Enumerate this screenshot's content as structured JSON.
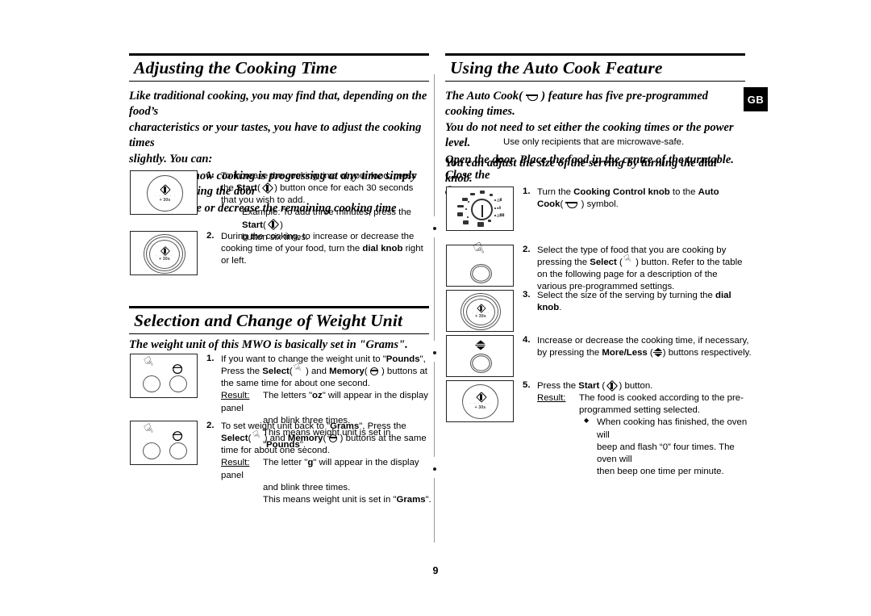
{
  "page": {
    "number": "9",
    "locale_badge": "GB"
  },
  "left_column": {
    "section1": {
      "heading": "Adjusting the Cooking Time",
      "intro": [
        "Like traditional cooking, you may find that, depending on the food’s",
        "characteristics or your tastes, you have to adjust the cooking times",
        "slightly. You can:"
      ],
      "bullets": [
        "Check how cooking is progressing at any time simply by opening the door",
        "Increase or decrease the remaining cooking time"
      ],
      "steps": [
        {
          "num": "1.",
          "line1_a": "To increase the cooking time of your food, press the",
          "line2_a": "Start",
          "line2_b": ") button once for each 30 seconds that you wish",
          "line3": "to add.",
          "sub_a": "Example: To add three minutes, press the ",
          "sub_b": "Start",
          "sub_c": ")",
          "sub_d": "button six times.",
          "panel": {
            "icon": "start-button-panel",
            "label": "+ 30s"
          }
        },
        {
          "num": "2.",
          "line1": "During the cooking, to increase or decrease the cooking",
          "line2_a": "time of your food, turn the ",
          "line2_b": "dial knob",
          "line2_c": " right or left.",
          "panel": {
            "icon": "dial-knob-panel",
            "label": "+ 30s"
          }
        }
      ]
    },
    "section2": {
      "heading": "Selection and Change of Weight Unit",
      "intro": [
        "The weight unit of this MWO is basically set in \"Grams\"."
      ],
      "steps": [
        {
          "num": "1.",
          "line1_a": "If you want to change the weight unit to \"",
          "line1_b": "Pounds",
          "line1_c": "\",",
          "line2_a": "Press the ",
          "line2_b": "Select",
          "line2_c": ") and ",
          "line2_d": "Memory",
          "line2_e": ") buttons at the",
          "line3": "same time for about one second.",
          "result_label": "Result:",
          "result_1a": "The letters \"",
          "result_1b": "oz",
          "result_1c": "\" will appear in the display panel",
          "result_2": "and blink three times.",
          "result_3a": "This means weight unit is set in \"",
          "result_3b": "Pounds",
          "result_3c": "\".",
          "panel": {
            "icon": "select-memory-buttons-panel"
          }
        },
        {
          "num": "2.",
          "line1_a": "To set weight unit back to \"",
          "line1_b": "Grams",
          "line1_c": "\",",
          "line2_a": "Press the ",
          "line2_b": "Select",
          "line2_c": ") and ",
          "line2_d": "Memory",
          "line2_e": ") buttons at the",
          "line3": "same time for about one second.",
          "result_label": "Result:",
          "result_1a": "The letter \"",
          "result_1b": "g",
          "result_1c": "\" will appear in the display panel",
          "result_2": "and blink three times.",
          "result_3a": "This means weight unit is set in \"",
          "result_3b": "Grams",
          "result_3c": "\".",
          "panel": {
            "icon": "select-memory-buttons-panel"
          }
        }
      ]
    }
  },
  "right_column": {
    "section1": {
      "heading": "Using the Auto Cook Feature",
      "intro_1a": "The Auto Cook(",
      "intro_1b": ") feature has five pre-programmed cooking times.",
      "intro_2": "You do not need to set either the cooking times or the power level.",
      "intro_3": "You can adjust the size of the serving by turning the dial knob.",
      "note": "Use only recipients that are microwave-safe.",
      "intro_4a": "Open the door. Place the food in the centre of the turntable. Close the",
      "intro_4b": "door.",
      "steps": [
        {
          "num": "1.",
          "line1_a": "Turn the ",
          "line1_b": "Cooking Control knob",
          "line1_c": " to the ",
          "line1_d": "Auto Cook",
          "line1_e": ")",
          "line2": "symbol.",
          "panel": {
            "icon": "cooking-control-knob-panel",
            "dial_symbols": [
              "Auto Reheat",
              "Auto Defrost",
              "Grill",
              "Combi I",
              "Combi II",
              "Power",
              "Auto Cook"
            ]
          }
        },
        {
          "num": "2.",
          "line1": "Select the type of food that you are cooking by pressing",
          "line2_a": "the ",
          "line2_b": "Select",
          "line2_c": ") button. Refer to the table on the following",
          "line3": "page for a description of the various pre-programmed",
          "line4": "settings.",
          "panel": {
            "icon": "select-button-panel"
          }
        },
        {
          "num": "3.",
          "line1_a": "Select the size of the serving by turning the ",
          "line1_b": "dial knob",
          "line1_c": ".",
          "panel": {
            "icon": "dial-knob-panel",
            "label": "+ 30s"
          }
        },
        {
          "num": "4.",
          "line1": "Increase or decrease the cooking time, if necessary, by",
          "line2_a": "pressing the ",
          "line2_b": "More/Less",
          "line2_c": ") buttons respectively.",
          "panel": {
            "icon": "more-less-button-panel"
          }
        },
        {
          "num": "5.",
          "line1_a": "Press the ",
          "line1_b": "Start",
          "line1_c": ") button.",
          "result_label": "Result:",
          "result_1": "The food is cooked according to the pre-",
          "result_2": "programmed setting selected.",
          "bullet_1": "When cooking has finished, the oven will",
          "bullet_2": "beep and flash “0” four times. The oven will",
          "bullet_3": "then beep one time per minute.",
          "panel": {
            "icon": "start-button-panel",
            "label": "+ 30s"
          }
        }
      ]
    }
  },
  "colors": {
    "text": "#000000",
    "rule": "#000000",
    "badge_bg": "#000000",
    "badge_fg": "#ffffff",
    "panel_border": "#222222",
    "fold_line": "#9a9a9a"
  }
}
